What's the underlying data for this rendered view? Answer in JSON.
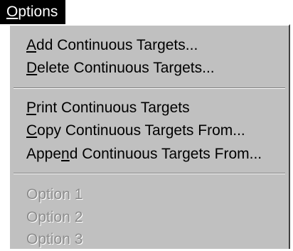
{
  "menubar": {
    "active_menu": {
      "mnemonic": "O",
      "rest": "ptions"
    }
  },
  "menu": {
    "items": [
      {
        "pre": "",
        "mnemonic": "A",
        "post": "dd Continuous Targets...",
        "enabled": true
      },
      {
        "pre": "",
        "mnemonic": "D",
        "post": "elete Continuous Targets...",
        "enabled": true
      },
      {
        "pre": "",
        "mnemonic": "P",
        "post": "rint Continuous Targets",
        "enabled": true
      },
      {
        "pre": "",
        "mnemonic": "C",
        "post": "opy Continuous Targets From...",
        "enabled": true
      },
      {
        "pre": "Appe",
        "mnemonic": "n",
        "post": "d Continuous Targets From...",
        "enabled": true
      },
      {
        "label": "Option 1",
        "enabled": false
      },
      {
        "label": "Option 2",
        "enabled": false
      },
      {
        "label": "Option 3",
        "enabled": false
      }
    ]
  },
  "colors": {
    "menu_background": "#c0c0c0",
    "highlight_background": "#000000",
    "highlight_text": "#ffffff",
    "disabled_text": "#8c8c8c"
  }
}
